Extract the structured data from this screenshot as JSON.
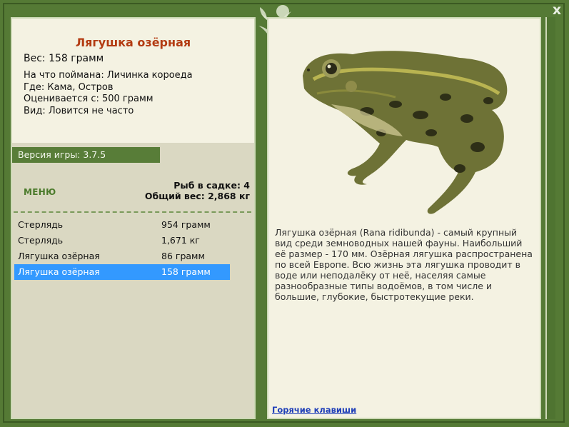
{
  "window": {
    "close_label": "x"
  },
  "fish": {
    "title": "Лягушка озёрная",
    "weight": "Вес: 158 грамм",
    "bait": "На что поймана: Личинка короеда",
    "location": "Где: Кама, Остров",
    "valued_from": "Оценивается с: 500 грамм",
    "view": "Вид: Ловится не часто"
  },
  "version": "Версия игры: 3.7.5",
  "menu_label": "МЕНЮ",
  "summary": {
    "fish_count": "Рыб в садке: 4",
    "total_weight": "Общий вес: 2,868 кг"
  },
  "catch_list": [
    {
      "name": "Стерлядь",
      "weight": "954 грамм"
    },
    {
      "name": "Стерлядь",
      "weight": "1,671 кг"
    },
    {
      "name": "Лягушка озёрная",
      "weight": "86 грамм"
    },
    {
      "name": "Лягушка озёрная",
      "weight": "158 грамм"
    }
  ],
  "selected_index": 3,
  "description": "Лягушка озёрная (Rana ridibunda) - самый крупный вид среди земноводных нашей фауны. Наибольший её размер - 170 мм. Озёрная лягушка распространена по всей Европе. Всю жизнь эта лягушка проводит в воде или неподалёку от неё, населяя самые разнообразные типы водоёмов, в том числе и большие, глубокие, быстротекущие реки.",
  "hotkeys_link": "Горячие клавиши",
  "colors": {
    "frame": "#557a35",
    "title_red": "#b33b12",
    "selection": "#3399ff",
    "link": "#1f3fb8"
  },
  "icons": [
    "close-icon",
    "leaf-decoration-icon"
  ]
}
